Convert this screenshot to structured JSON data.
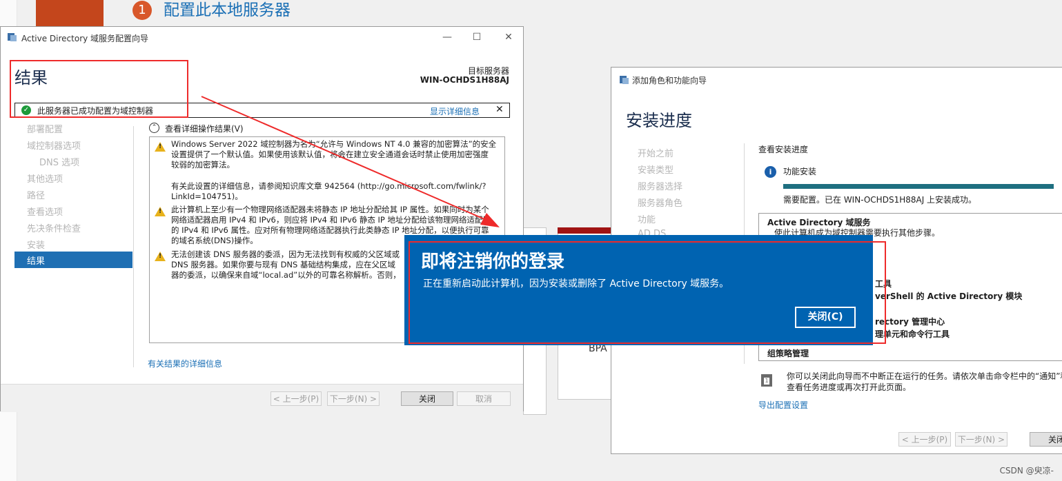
{
  "background": {
    "step_number": "1",
    "heading": "配置此本地服务器",
    "bpa_label": "BPA"
  },
  "adds_wizard": {
    "window_title": "Active Directory 域服务配置向导",
    "minimize": "—",
    "maximize": "☐",
    "close": "✕",
    "page_title": "结果",
    "target_server_label": "目标服务器",
    "target_server_value": "WIN-OCHDS1H88AJ",
    "banner": {
      "text": "此服务器已成功配置为域控制器",
      "link": "显示详细信息",
      "close": "✕"
    },
    "nav": [
      "部署配置",
      "域控制器选项",
      "DNS 选项",
      "其他选项",
      "路径",
      "查看选项",
      "先决条件检查",
      "安装",
      "结果"
    ],
    "expander_label": "查看详细操作结果(V)",
    "results": [
      {
        "type": "warning",
        "text": "Windows Server 2022 域控制器为名为“允许与 Windows NT 4.0 兼容的加密算法”的安全\n设置提供了一个默认值。如果使用该默认值，将会在建立安全通道会话时禁止使用加密强度\n较弱的加密算法。"
      },
      {
        "type": "info",
        "text": "有关此设置的详细信息，请参阅知识库文章 942564 (http://go.microsoft.com/fwlink/?\nLinkId=104751)。"
      },
      {
        "type": "warning",
        "text": "此计算机上至少有一个物理网络适配器未将静态 IP 地址分配给其 IP 属性。如果同时为某个\n网络适配器启用 IPv4 和 IPv6，则应将 IPv4 和 IPv6 静态 IP 地址分配给该物理网络适配器\n的 IPv4 和 IPv6 属性。应对所有物理网络适配器执行此类静态 IP 地址分配，以便执行可靠\n的域名系统(DNS)操作。"
      },
      {
        "type": "warning",
        "text": "无法创建该 DNS 服务器的委派，因为无法找到有权威的父区域或\nDNS 服务器。如果你要与现有 DNS 基础结构集成，应在父区域\n器的委派，以确保来自域“local.ad”以外的可靠名称解析。否则，"
      }
    ],
    "details_link": "有关结果的详细信息",
    "buttons": {
      "prev": "< 上一步(P)",
      "next": "下一步(N) >",
      "close": "关闭",
      "cancel": "取消"
    }
  },
  "roles_wizard": {
    "window_title": "添加角色和功能向导",
    "page_title": "安装进度",
    "nav": [
      "开始之前",
      "安装类型",
      "服务器选择",
      "服务器角色",
      "功能",
      "AD DS"
    ],
    "progress_title": "查看安装进度",
    "install_label": "功能安装",
    "progress": 1.0,
    "status": "需要配置。已在 WIN-OCHDS1H88AJ 上安装成功。",
    "list": [
      {
        "text": "Active Directory 域服务",
        "bold": true
      },
      {
        "text": "使此计算机成为域控制器需要执行其他步骤。",
        "bold": false
      },
      {
        "text": "工具",
        "bold": true
      },
      {
        "text": "verShell 的 Active Directory 模块",
        "bold": true
      },
      {
        "text": "rectory 管理中心",
        "bold": true
      },
      {
        "text": "理单元和命令行工具",
        "bold": true
      },
      {
        "text": "组策略管理",
        "bold": true
      }
    ],
    "note": "你可以关闭此向导而不中断正在运行的任务。请依次单击命令栏中的“通知”和\n查看任务进度或再次打开此页面。",
    "export_link": "导出配置设置",
    "buttons": {
      "prev": "< 上一步(P)",
      "next": "下一步(N) >",
      "close": "关闭"
    }
  },
  "signout_dialog": {
    "title": "即将注销你的登录",
    "message": "正在重新启动此计算机，因为安装或删除了 Active Directory 域服务。",
    "close_button": "关闭(C)"
  },
  "watermark": "CSDN @臾凉-",
  "colors": {
    "accent_blue": "#1f6fb3",
    "dialog_blue": "#0063b1",
    "annotation_red": "#ee2a2a",
    "success_green": "#1d9a3a",
    "warning_yellow": "#e8b21b"
  }
}
